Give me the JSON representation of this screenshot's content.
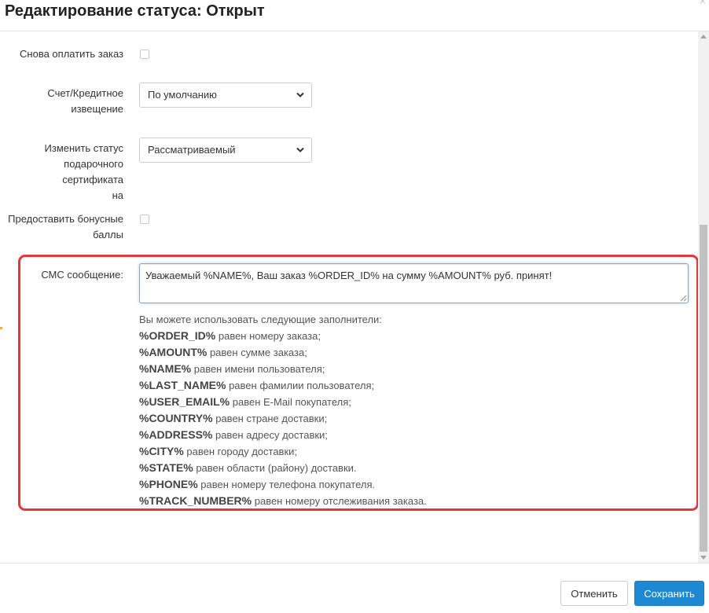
{
  "header": {
    "title": "Редактирование статуса: Открыт",
    "close_symbol": "×"
  },
  "form": {
    "repay_order_label": "Снова оплатить заказ",
    "invoice_label_line1": "Счет/Кредитное",
    "invoice_label_line2": "извещение",
    "invoice_value": "По умолчанию",
    "gift_status_label_line1": "Изменить статус",
    "gift_status_label_line2": "подарочного сертификата",
    "gift_status_label_line3": "на",
    "gift_status_value": "Рассматриваемый",
    "bonus_label_line1": "Предоставить бонусные",
    "bonus_label_line2": "баллы",
    "sms_label": "СМС сообщение:",
    "sms_value": "Уважаемый %NAME%, Ваш заказ %ORDER_ID% на сумму %AMOUNT% руб. принят!"
  },
  "help": {
    "intro": "Вы можете использовать следующие заполнители:",
    "placeholders": [
      {
        "key": "%ORDER_ID%",
        "desc": " равен номеру заказа;"
      },
      {
        "key": "%AMOUNT%",
        "desc": " равен сумме заказа;"
      },
      {
        "key": "%NAME%",
        "desc": " равен имени пользователя;"
      },
      {
        "key": "%LAST_NAME%",
        "desc": " равен фамилии пользователя;"
      },
      {
        "key": "%USER_EMAIL%",
        "desc": " равен E-Mail покупателя;"
      },
      {
        "key": "%COUNTRY%",
        "desc": " равен стране доставки;"
      },
      {
        "key": "%ADDRESS%",
        "desc": " равен адресу доставки;"
      },
      {
        "key": "%CITY%",
        "desc": " равен городу доставки;"
      },
      {
        "key": "%STATE%",
        "desc": " равен области (району) доставки."
      },
      {
        "key": "%PHONE%",
        "desc": " равен номеру телефона покупателя."
      },
      {
        "key": "%TRACK_NUMBER%",
        "desc": " равен номеру отслеживания заказа."
      }
    ]
  },
  "footer": {
    "cancel_label": "Отменить",
    "save_label": "Сохранить"
  },
  "colors": {
    "highlight_border": "#e0383d",
    "primary_button": "#1e88d3"
  }
}
